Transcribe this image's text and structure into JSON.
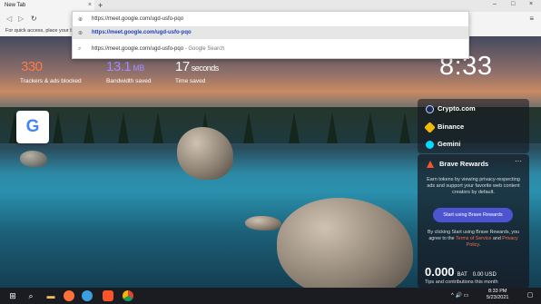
{
  "browser": {
    "tab_title": "New Tab",
    "tab_close": "×",
    "new_tab": "+",
    "win_minimize": "–",
    "win_maximize": "□",
    "win_close": "×",
    "nav_back": "◁",
    "nav_forward": "▷",
    "nav_reload": "↻",
    "menu": "≡",
    "bookmarks_hint": "For quick access, place your bookmarks here on the bookmarks bar."
  },
  "omnibox": {
    "input_value": "https://meet.google.com/ugd-usfo-pqo",
    "selected_suggestion": "https://meet.google.com/ugd-usfo-pqo",
    "search_suggestion": "https://meet.google.com/ugd-usfo-pqo",
    "search_suffix": " - Google Search"
  },
  "stats": [
    {
      "value": "330",
      "unit": "",
      "label": "Trackers & ads blocked",
      "color": "#ff7a45"
    },
    {
      "value": "13.1",
      "unit": "MB",
      "label": "Bandwidth saved",
      "color": "#a58bff"
    },
    {
      "value": "17",
      "unit": "seconds",
      "label": "Time saved",
      "color": "#ffffff"
    }
  ],
  "clock": "8:33",
  "top_site": {
    "letter": "G",
    "name": "google-tile"
  },
  "widgets": [
    {
      "label": "Crypto.com",
      "color": "#1a2b5e",
      "icon": "crypto-com-icon"
    },
    {
      "label": "Binance",
      "color": "#f0b90b",
      "icon": "binance-icon"
    },
    {
      "label": "Gemini",
      "color": "#00dcfa",
      "icon": "gemini-icon"
    }
  ],
  "rewards": {
    "title": "Brave Rewards",
    "more": "···",
    "description": "Earn tokens by viewing privacy-respecting ads and support your favorite web content creators by default.",
    "button": "Start using Brave Rewards",
    "terms_prefix": "By clicking Start using Brave Rewards, you agree to the ",
    "terms_link": "Terms of Service",
    "terms_and": " and ",
    "privacy_link": "Privacy Policy",
    "terms_end": ".",
    "balance": "0.000",
    "balance_unit": "BAT",
    "usd": "0.00 USD",
    "tips": "Tips and contributions this month"
  },
  "taskbar": {
    "start": "⊞",
    "search": "⌕",
    "tray": "^  🔊 ▭",
    "time": "8:33 PM",
    "date": "5/23/2021"
  }
}
